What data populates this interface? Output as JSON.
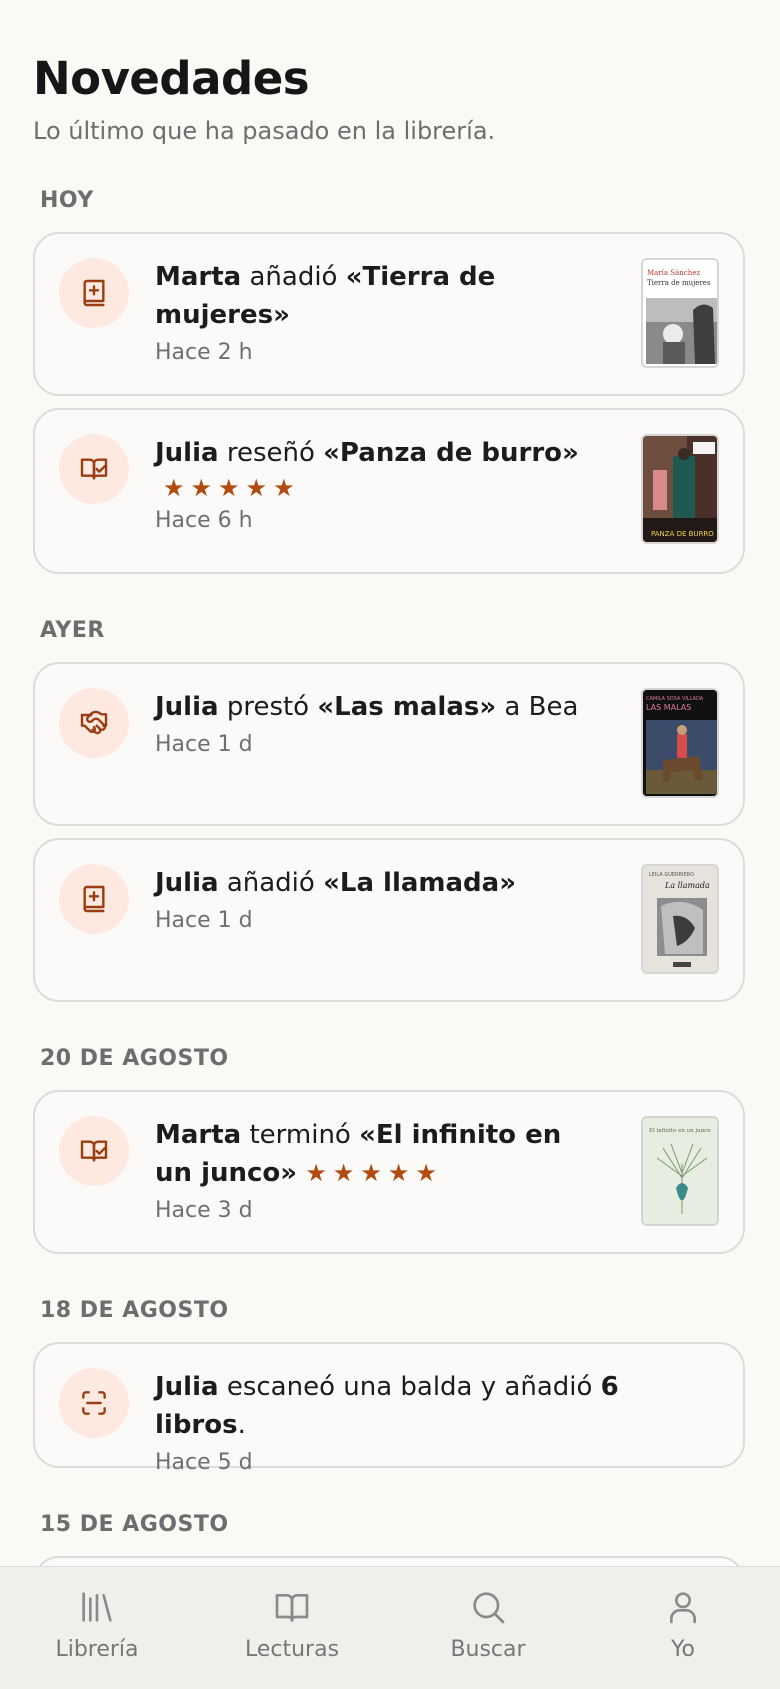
{
  "header": {
    "title": "Novedades",
    "subtitle": "Lo último que ha pasado en la librería."
  },
  "sections": {
    "hoy": "HOY",
    "ayer": "AYER",
    "ago20": "20 DE AGOSTO",
    "ago18": "18 DE AGOSTO",
    "ago15": "15 DE AGOSTO"
  },
  "feed": [
    {
      "icon": "book-plus-icon",
      "user": "Marta",
      "verb": " añadió ",
      "book": "«Tierra de mujeres»",
      "time": "Hace 2 h",
      "cover": {
        "author": "María Sánchez",
        "title": "Tierra de mujeres"
      }
    },
    {
      "icon": "book-check-icon",
      "user": "Julia",
      "verb": " reseñó ",
      "book": "«Panza de burro»",
      "rating": 5,
      "stars": "★★★★★",
      "time": "Hace 6 h",
      "cover": {
        "title": "PANZA DE BURRO"
      }
    },
    {
      "icon": "handshake-icon",
      "user": "Julia",
      "verb": " prestó ",
      "book": "«Las malas»",
      "tail": " a Bea",
      "time": "Hace 1 d",
      "cover": {
        "author": "CAMILA SOSA VILLADA",
        "title": "LAS MALAS"
      }
    },
    {
      "icon": "book-plus-icon",
      "user": "Julia",
      "verb": " añadió ",
      "book": "«La llamada»",
      "time": "Hace 1 d",
      "cover": {
        "author": "LEILA GUERRIERO",
        "title": "La llamada"
      }
    },
    {
      "icon": "book-check-icon",
      "user": "Marta",
      "verb": " terminó ",
      "book": "«El infinito en un junco»",
      "rating": 5,
      "stars": "★★★★★",
      "time": "Hace 3 d",
      "cover": {
        "title": "El infinito en un junco"
      }
    },
    {
      "icon": "scan-icon",
      "user": "Julia",
      "verb": " escaneó una balda y añadió ",
      "count": "6 libros",
      "tail": ".",
      "time": "Hace 5 d"
    }
  ],
  "tabs": [
    {
      "icon": "library-icon",
      "label": "Librería"
    },
    {
      "icon": "open-book-icon",
      "label": "Lecturas"
    },
    {
      "icon": "search-icon",
      "label": "Buscar"
    },
    {
      "icon": "user-icon",
      "label": "Yo"
    }
  ],
  "colors": {
    "accent": "#b24b10",
    "icon_bg": "#fde9df",
    "background": "#faf9f6"
  }
}
